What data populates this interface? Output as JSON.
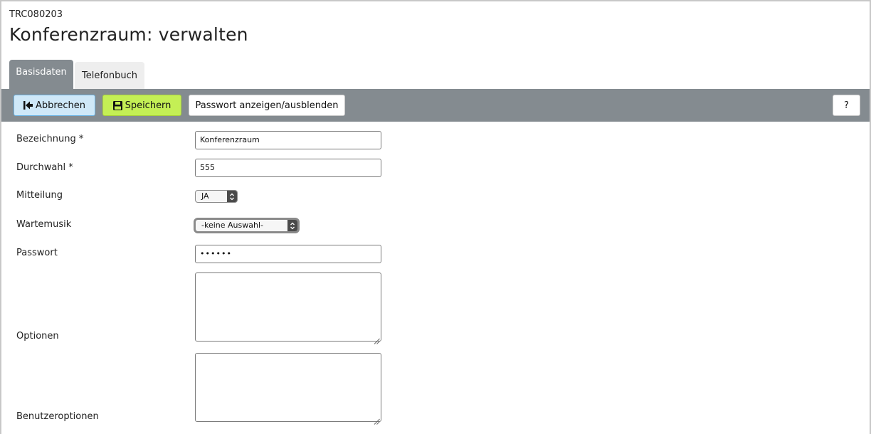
{
  "header": {
    "code": "TRC080203",
    "title": "Konferenzraum: verwalten"
  },
  "tabs": [
    {
      "label": "Basisdaten",
      "active": true
    },
    {
      "label": "Telefonbuch",
      "active": false
    }
  ],
  "toolbar": {
    "cancel_label": "Abbrechen",
    "cancel_icon": "step-back-icon",
    "save_label": "Speichern",
    "save_icon": "floppy-disk-icon",
    "password_toggle_label": "Passwort anzeigen/ausblenden",
    "help_label": "?"
  },
  "form": {
    "bezeichnung": {
      "label": "Bezeichnung *",
      "value": "Konferenzraum"
    },
    "durchwahl": {
      "label": "Durchwahl *",
      "value": "555"
    },
    "mitteilung": {
      "label": "Mitteilung",
      "value": "JA"
    },
    "wartemusik": {
      "label": "Wartemusik",
      "value": "-keine Auswahl-"
    },
    "passwort": {
      "label": "Passwort",
      "value": "••••••"
    },
    "optionen": {
      "label": "Optionen",
      "value": ""
    },
    "benutzeroptionen": {
      "label": "Benutzeroptionen",
      "value": ""
    }
  },
  "colors": {
    "toolbar_bg": "#848b90",
    "cancel_bg": "#cfe8f8",
    "save_bg": "#c4ef55"
  }
}
